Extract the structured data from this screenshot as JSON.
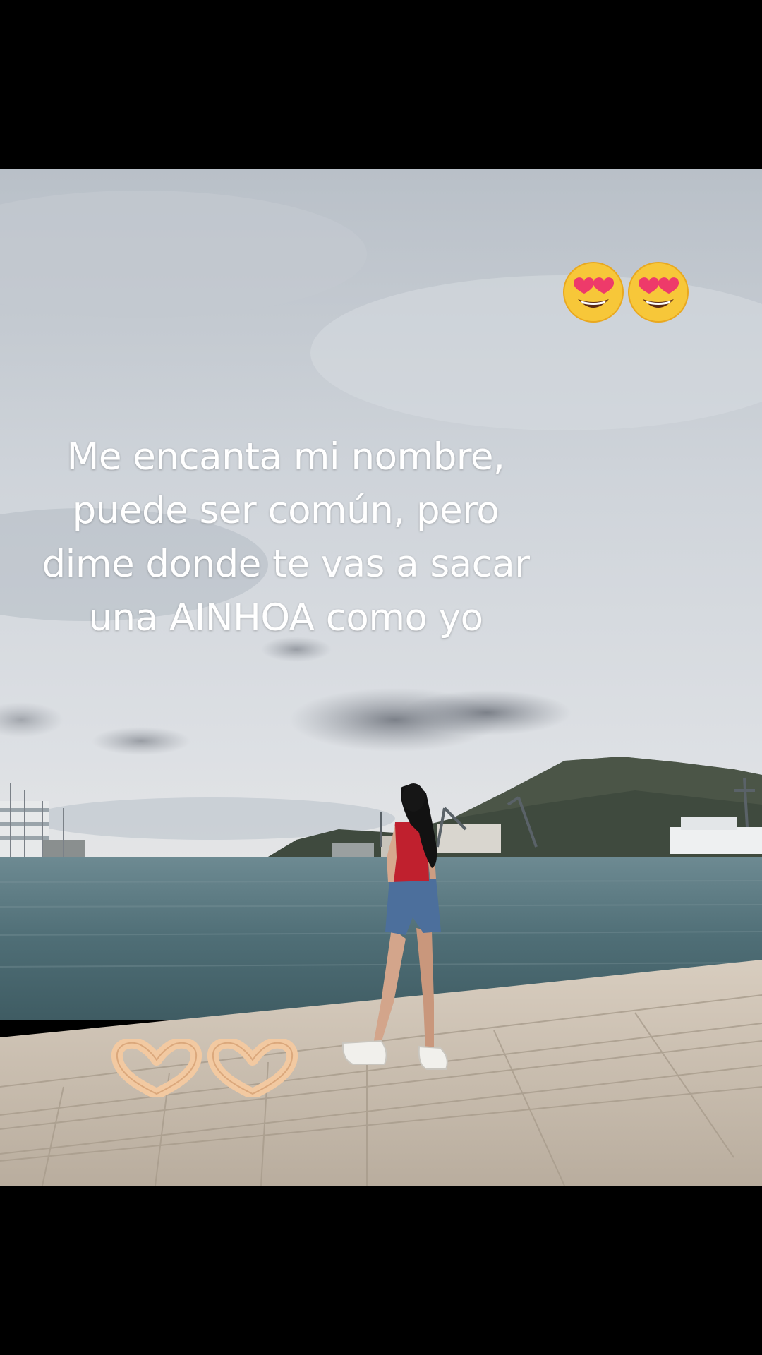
{
  "caption": {
    "lines": [
      "Me encanta mi nombre,",
      "puede ser común, pero",
      "dime donde te vas a sacar",
      "una AINHOA como yo"
    ]
  },
  "stickers": {
    "top": [
      "heart-eyes-emoji",
      "heart-eyes-emoji"
    ],
    "bottom": [
      "heart-hands-emoji",
      "heart-hands-emoji"
    ]
  },
  "colors": {
    "sky": "#c9cfd6",
    "sea": "#4d6b72",
    "promenade": "#cfc3b3",
    "top_shirt": "#c0202e",
    "shorts": "#4c6f9c"
  }
}
